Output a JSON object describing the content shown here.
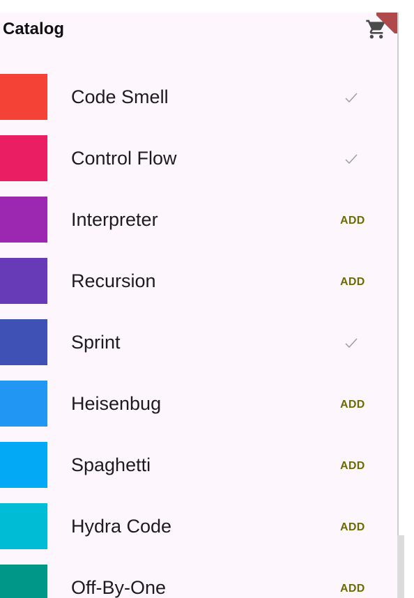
{
  "app_bar": {
    "title": "Catalog",
    "cart_icon": "shopping-cart-icon"
  },
  "colors": {
    "background": "#fdf7fd",
    "add_text": "#6b6b00",
    "check": "#9e9e9e"
  },
  "items": [
    {
      "name": "Code Smell",
      "color": "#f44336",
      "in_cart": true,
      "action_label": "✓"
    },
    {
      "name": "Control Flow",
      "color": "#e91e63",
      "in_cart": true,
      "action_label": "✓"
    },
    {
      "name": "Interpreter",
      "color": "#9c27b0",
      "in_cart": false,
      "action_label": "ADD"
    },
    {
      "name": "Recursion",
      "color": "#673ab7",
      "in_cart": false,
      "action_label": "ADD"
    },
    {
      "name": "Sprint",
      "color": "#3f51b5",
      "in_cart": true,
      "action_label": "✓"
    },
    {
      "name": "Heisenbug",
      "color": "#2196f3",
      "in_cart": false,
      "action_label": "ADD"
    },
    {
      "name": "Spaghetti",
      "color": "#03a9f4",
      "in_cart": false,
      "action_label": "ADD"
    },
    {
      "name": "Hydra Code",
      "color": "#00bcd4",
      "in_cart": false,
      "action_label": "ADD"
    },
    {
      "name": "Off-By-One",
      "color": "#009688",
      "in_cart": false,
      "action_label": "ADD"
    }
  ]
}
